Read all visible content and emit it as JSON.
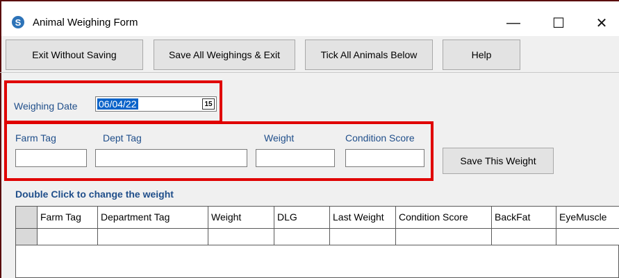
{
  "window": {
    "title": "Animal Weighing Form",
    "icon_letter": "S",
    "minimize_glyph": "—",
    "maximize_glyph": "☐",
    "close_glyph": "✕"
  },
  "toolbar": {
    "exit_label": "Exit Without Saving",
    "save_all_label": "Save All Weighings & Exit",
    "tick_all_label": "Tick All Animals Below",
    "help_label": "Help"
  },
  "weighing_date": {
    "label": "Weighing Date",
    "value": "06/04/22",
    "calendar_icon_text": "15"
  },
  "entry": {
    "farm_tag_label": "Farm Tag",
    "dept_tag_label": "Dept Tag",
    "weight_label": "Weight",
    "condition_label": "Condition Score",
    "farm_tag_value": "",
    "dept_tag_value": "",
    "weight_value": "",
    "condition_value": "",
    "save_button_label": "Save This Weight"
  },
  "grid": {
    "caption": "Double Click to change the weight",
    "columns": [
      "Farm Tag",
      "Department Tag",
      "Weight",
      "DLG",
      "Last Weight",
      "Condition Score",
      "BackFat",
      "EyeMuscle"
    ]
  },
  "colors": {
    "highlight_box": "#e00000",
    "label_blue": "#1f4e8a",
    "selection": "#0a63c9"
  }
}
